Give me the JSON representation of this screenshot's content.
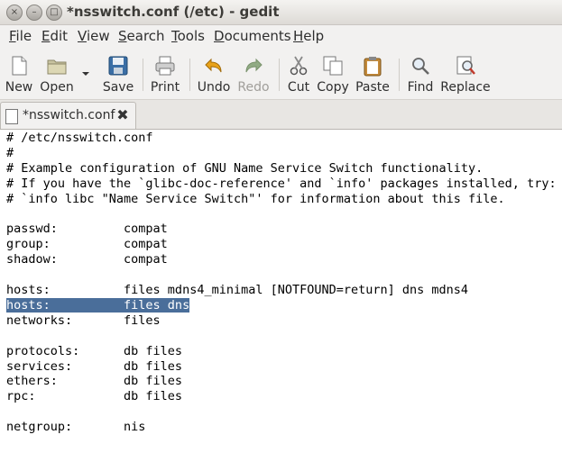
{
  "window": {
    "title": "*nsswitch.conf (/etc) - gedit",
    "close_glyph": "×",
    "min_glyph": "–",
    "max_glyph": "□"
  },
  "menu": [
    {
      "label": "File",
      "accel": "F",
      "rest": "ile"
    },
    {
      "label": "Edit",
      "accel": "E",
      "rest": "dit"
    },
    {
      "label": "View",
      "accel": "V",
      "rest": "iew"
    },
    {
      "label": "Search",
      "accel": "S",
      "rest": "earch"
    },
    {
      "label": "Tools",
      "accel": "T",
      "rest": "ools"
    },
    {
      "label": "Documents",
      "accel": "D",
      "rest": "ocuments"
    },
    {
      "label": "Help",
      "accel": "H",
      "rest": "elp"
    }
  ],
  "toolbar": {
    "new": "New",
    "open": "Open",
    "save": "Save",
    "print": "Print",
    "undo": "Undo",
    "redo": "Redo",
    "cut": "Cut",
    "copy": "Copy",
    "paste": "Paste",
    "find": "Find",
    "replace": "Replace"
  },
  "tab": {
    "label": "*nsswitch.conf"
  },
  "editor": {
    "lines": [
      "# /etc/nsswitch.conf",
      "#",
      "# Example configuration of GNU Name Service Switch functionality.",
      "# If you have the `glibc-doc-reference' and `info' packages installed, try:",
      "# `info libc \"Name Service Switch\"' for information about this file.",
      "",
      "passwd:         compat",
      "group:          compat",
      "shadow:         compat",
      "",
      "hosts:          files mdns4_minimal [NOTFOUND=return] dns mdns4",
      "hosts:          files dns",
      "networks:       files",
      "",
      "protocols:      db files",
      "services:       db files",
      "ethers:         db files",
      "rpc:            db files",
      "",
      "netgroup:       nis"
    ],
    "selected_line": 11
  }
}
